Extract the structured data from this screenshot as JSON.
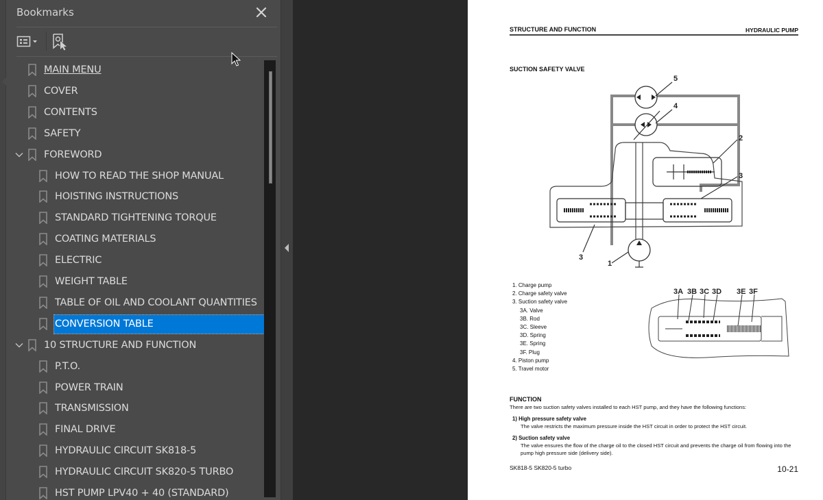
{
  "bookmarks_panel": {
    "title": "Bookmarks",
    "close_icon": "close-icon",
    "toolbar": {
      "options_icon": "bookmark-options-icon",
      "find_icon": "find-current-bookmark-icon"
    },
    "items": [
      {
        "label": "MAIN MENU",
        "level": 0,
        "expandable": false,
        "underlined": true,
        "selected": false
      },
      {
        "label": "COVER",
        "level": 0,
        "expandable": false,
        "underlined": false,
        "selected": false
      },
      {
        "label": "CONTENTS",
        "level": 0,
        "expandable": false,
        "underlined": false,
        "selected": false
      },
      {
        "label": "SAFETY",
        "level": 0,
        "expandable": false,
        "underlined": false,
        "selected": false
      },
      {
        "label": "FOREWORD",
        "level": 0,
        "expandable": true,
        "expanded": true,
        "underlined": false,
        "selected": false
      },
      {
        "label": "HOW TO READ THE SHOP MANUAL",
        "level": 1,
        "expandable": false,
        "underlined": false,
        "selected": false
      },
      {
        "label": "HOISTING INSTRUCTIONS",
        "level": 1,
        "expandable": false,
        "underlined": false,
        "selected": false
      },
      {
        "label": "STANDARD TIGHTENING TORQUE",
        "level": 1,
        "expandable": false,
        "underlined": false,
        "selected": false
      },
      {
        "label": "COATING MATERIALS",
        "level": 1,
        "expandable": false,
        "underlined": false,
        "selected": false
      },
      {
        "label": "ELECTRIC",
        "level": 1,
        "expandable": false,
        "underlined": false,
        "selected": false
      },
      {
        "label": "WEIGHT TABLE",
        "level": 1,
        "expandable": false,
        "underlined": false,
        "selected": false
      },
      {
        "label": "TABLE OF OIL AND COOLANT QUANTITIES",
        "level": 1,
        "expandable": false,
        "underlined": false,
        "selected": false
      },
      {
        "label": "CONVERSION TABLE",
        "level": 1,
        "expandable": false,
        "underlined": false,
        "selected": true
      },
      {
        "label": "10 STRUCTURE AND FUNCTION",
        "level": 0,
        "expandable": true,
        "expanded": true,
        "underlined": false,
        "selected": false
      },
      {
        "label": "P.T.O.",
        "level": 1,
        "expandable": false,
        "underlined": false,
        "selected": false
      },
      {
        "label": "POWER TRAIN",
        "level": 1,
        "expandable": false,
        "underlined": false,
        "selected": false
      },
      {
        "label": "TRANSMISSION",
        "level": 1,
        "expandable": false,
        "underlined": false,
        "selected": false
      },
      {
        "label": "FINAL DRIVE",
        "level": 1,
        "expandable": false,
        "underlined": false,
        "selected": false
      },
      {
        "label": "HYDRAULIC CIRCUIT SK818-5",
        "level": 1,
        "expandable": false,
        "underlined": false,
        "selected": false
      },
      {
        "label": "HYDRAULIC CIRCUIT SK820-5 TURBO",
        "level": 1,
        "expandable": false,
        "underlined": false,
        "selected": false
      },
      {
        "label": "HST PUMP LPV40 + 40 (STANDARD)",
        "level": 1,
        "expandable": false,
        "underlined": false,
        "selected": false
      }
    ]
  },
  "colors": {
    "selection": "#0078d7",
    "panel_bg": "#4a4a4a",
    "doc_bg": "#282828"
  },
  "document_page": {
    "header_left": "STRUCTURE AND FUNCTION",
    "header_right": "HYDRAULIC PUMP",
    "section_title": "SUCTION SAFETY VALVE",
    "diagram1_callouts": [
      "5",
      "4",
      "2",
      "3",
      "3",
      "1"
    ],
    "diagram2_callouts": [
      "3A",
      "3B",
      "3C",
      "3D",
      "3E",
      "3F"
    ],
    "legend": [
      {
        "text": "1.  Charge pump",
        "sub": false
      },
      {
        "text": "2.  Charge safety valve",
        "sub": false
      },
      {
        "text": "3.  Suction safety valve",
        "sub": false
      },
      {
        "text": "3A.  Valve",
        "sub": true
      },
      {
        "text": "3B.  Rod",
        "sub": true
      },
      {
        "text": "3C.  Sleeve",
        "sub": true
      },
      {
        "text": "3D.  Spring",
        "sub": true
      },
      {
        "text": "3E.  Spring",
        "sub": true
      },
      {
        "text": "3F.  Plug",
        "sub": true
      },
      {
        "text": "4.  Piston pump",
        "sub": false
      },
      {
        "text": "5.  Travel motor",
        "sub": false
      }
    ],
    "function_title": "FUNCTION",
    "function_intro": "There are two suction safety valves installed to each HST pump, and they have the following functions:",
    "function_items": [
      {
        "title": "1)  High pressure safety valve",
        "text": "The valve restricts the maximum pressure inside the HST circuit in order to protect the HST circuit."
      },
      {
        "title": "2)  Suction safety valve",
        "text": "The valve ensures the flow of the charge oil to the closed HST circuit and prevents the charge oil from flowing into the pump high pressure side (delivery side)."
      }
    ],
    "footer_left": "SK818-5  SK820-5 turbo",
    "footer_right": "10-21"
  }
}
